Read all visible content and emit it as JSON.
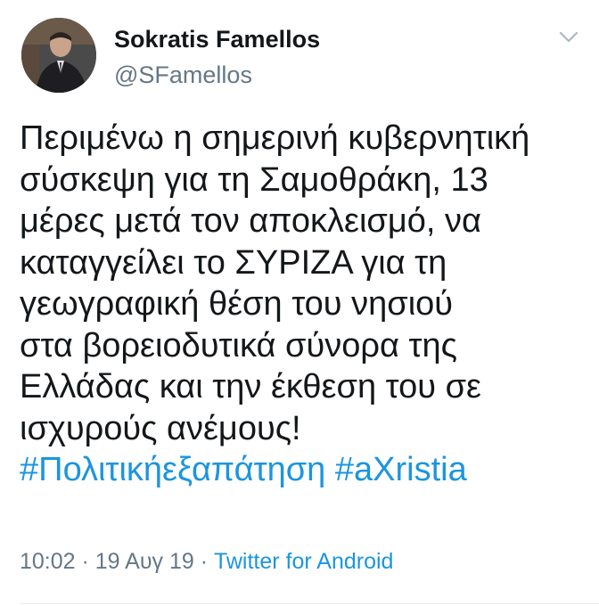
{
  "author": {
    "name": "Sokratis Famellos",
    "handle": "@SFamellos"
  },
  "tweet": {
    "lines": [
      "Περιμένω η σημερινή κυβερνητική",
      "σύσκεψη για τη Σαμοθράκη, 13",
      "μέρες μετά τον αποκλεισμό, να",
      "καταγγείλει το ΣΥΡΙΖΑ για τη",
      "γεωγραφική θέση του νησιού",
      "στα βορειοδυτικά σύνορα της",
      "Ελλάδας και την έκθεση του σε",
      "ισχυρούς ανέμους!"
    ],
    "hashtags": [
      "#Πολιτικήεξαπάτηση",
      "#aXristia"
    ]
  },
  "meta": {
    "time": "10:02",
    "separator": " · ",
    "date": "19 Αυγ 19",
    "source": "Twitter for Android"
  },
  "colors": {
    "text": "#14171a",
    "secondary": "#657786",
    "link": "#1b95e0"
  },
  "icons": {
    "menu": "chevron-down-icon"
  }
}
